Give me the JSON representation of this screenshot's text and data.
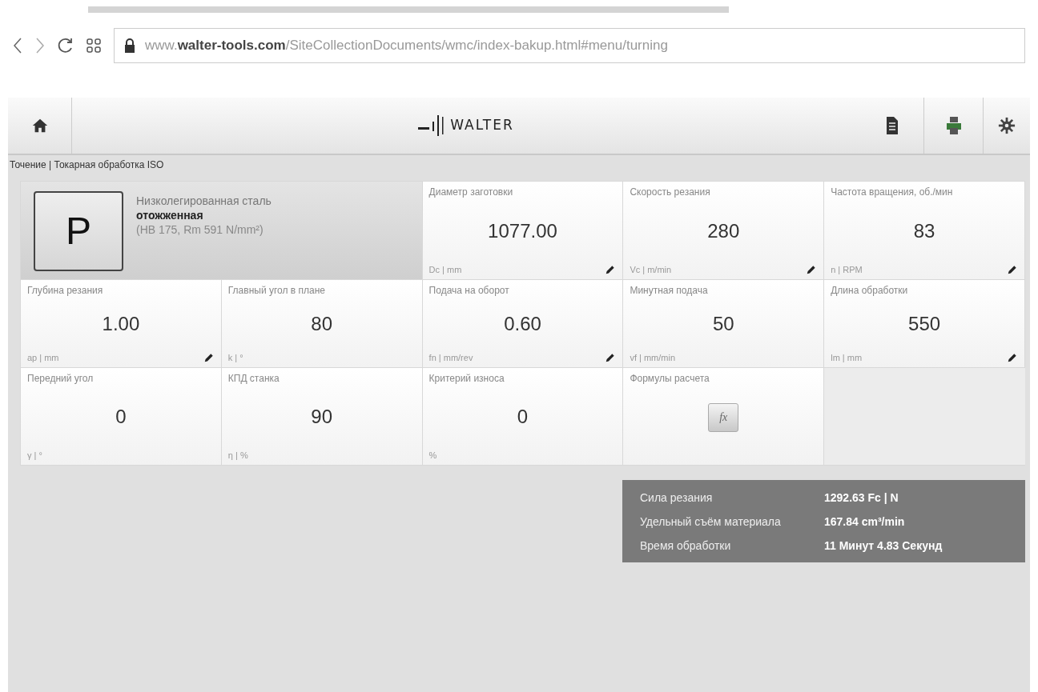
{
  "browser": {
    "url": "www.**walter-tools.com**/SiteCollectionDocuments/wmc/index-bakup.html#menu/turning"
  },
  "header": {
    "logo": "WALTER"
  },
  "breadcrumb": "Точение | Токарная обработка ISO",
  "material": {
    "letter": "P",
    "name": "Низколегированная сталь",
    "condition": "отожженная",
    "properties": "(HB 175, Rm 591 N/mm²)"
  },
  "cells": [
    {
      "kind": "field",
      "label": "Диаметр заготовки",
      "value": "1077.00",
      "unit": "Dc | mm",
      "editable": true
    },
    {
      "kind": "field",
      "label": "Скорость резания",
      "value": "280",
      "unit": "Vc | m/min",
      "editable": true
    },
    {
      "kind": "field",
      "label": "Частота вращения, об./мин",
      "value": "83",
      "unit": "n | RPM",
      "editable": true
    },
    {
      "kind": "field",
      "label": "Глубина резания",
      "value": "1.00",
      "unit": "ap | mm",
      "editable": true
    },
    {
      "kind": "field",
      "label": "Главный угол в плане",
      "value": "80",
      "unit": "k | °",
      "editable": false
    },
    {
      "kind": "field",
      "label": "Подача на оборот",
      "value": "0.60",
      "unit": "fn | mm/rev",
      "editable": true
    },
    {
      "kind": "field",
      "label": "Минутная подача",
      "value": "50",
      "unit": "vf | mm/min",
      "editable": false
    },
    {
      "kind": "field",
      "label": "Длина обработки",
      "value": "550",
      "unit": "lm | mm",
      "editable": true
    },
    {
      "kind": "field",
      "label": "Передний угол",
      "value": "0",
      "unit": "γ | °",
      "editable": false
    },
    {
      "kind": "field",
      "label": "КПД станка",
      "value": "90",
      "unit": "η | %",
      "editable": false
    },
    {
      "kind": "field",
      "label": "Критерий износа",
      "value": "0",
      "unit": "%",
      "editable": false
    },
    {
      "kind": "formula",
      "label": "Формулы расчета",
      "button": "fx"
    },
    {
      "kind": "empty"
    }
  ],
  "results": [
    {
      "label": "Сила резания",
      "value": "1292.63 Fc | N"
    },
    {
      "label": "Удельный съём материала",
      "value": "167.84 cm³/min"
    },
    {
      "label": "Время обработки",
      "value": "11 Минут 4.83 Секунд"
    }
  ]
}
